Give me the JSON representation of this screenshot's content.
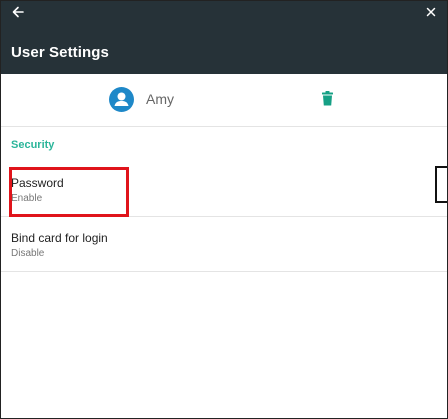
{
  "app": {
    "title": "User Settings"
  },
  "icons": {
    "back": "back-arrow-icon",
    "close": "close-icon",
    "avatar": "person-avatar-icon",
    "delete": "trash-icon"
  },
  "user": {
    "name": "Amy"
  },
  "security": {
    "header": "Security",
    "items": [
      {
        "title": "Password",
        "status": "Enable"
      },
      {
        "title": "Bind card for login",
        "status": "Disable"
      }
    ]
  },
  "colors": {
    "appbar": "#263238",
    "accent": "#1e88c8",
    "section": "#2bb59a",
    "trash": "#16a085",
    "highlight": "#e0141b"
  }
}
